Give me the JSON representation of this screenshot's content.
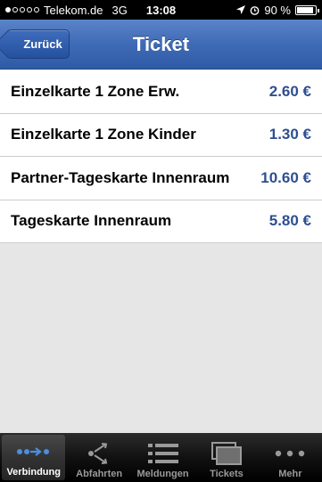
{
  "status_bar": {
    "carrier": "Telekom.de",
    "network": "3G",
    "time": "13:08",
    "battery": "90 %",
    "signal_bars_filled": 1,
    "signal_bars_total": 5,
    "battery_level_percent": 90
  },
  "nav": {
    "back_label": "Zurück",
    "title": "Ticket"
  },
  "tickets": [
    {
      "name": "Einzelkarte 1 Zone Erw.",
      "price": "2.60 €"
    },
    {
      "name": "Einzelkarte 1 Zone Kinder",
      "price": "1.30 €"
    },
    {
      "name": "Partner-Tageskarte Innenraum",
      "price": "10.60 €"
    },
    {
      "name": "Tageskarte Innenraum",
      "price": "5.80 €"
    }
  ],
  "tab_bar": {
    "tabs": [
      {
        "label": "Verbindung",
        "icon": "connection-icon",
        "active": true
      },
      {
        "label": "Abfahrten",
        "icon": "departures-icon",
        "active": false
      },
      {
        "label": "Meldungen",
        "icon": "messages-icon",
        "active": false
      },
      {
        "label": "Tickets",
        "icon": "tickets-icon",
        "active": false
      },
      {
        "label": "Mehr",
        "icon": "more-icon",
        "active": false
      }
    ]
  },
  "colors": {
    "nav_blue": "#3f6bb6",
    "price_blue": "#2d4f91",
    "active_tab_accent": "#4a8fe0"
  }
}
